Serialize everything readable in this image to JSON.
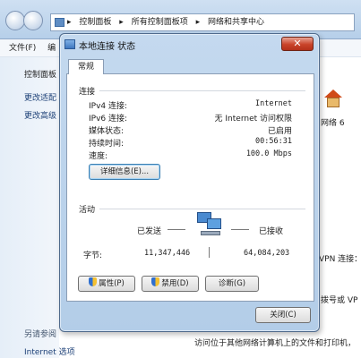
{
  "explorer": {
    "breadcrumb": [
      "控制面板",
      "所有控制面板项",
      "网络和共享中心"
    ],
    "separator": "▸",
    "menu": {
      "file": "文件(F)",
      "edit": "编"
    },
    "sidebar": {
      "home": "控制面板",
      "link1": "更改适配",
      "link2": "更改高级",
      "see_also": "另请参阅",
      "internet_options": "Internet 选项"
    },
    "main": {
      "network_label": "网络 6",
      "vpn_connection": "VPN 连接：",
      "dialup": "拨号或 VP",
      "access_info": "访问位于其他网络计算机上的文件和打印机，"
    }
  },
  "dialog": {
    "title": "本地连接 状态",
    "close_glyph": "✕",
    "tab_general": "常规",
    "connection": {
      "section_title": "连接",
      "rows": [
        {
          "label": "IPv4 连接:",
          "value": "Internet"
        },
        {
          "label": "IPv6 连接:",
          "value": "无 Internet 访问权限"
        },
        {
          "label": "媒体状态:",
          "value": "已启用"
        },
        {
          "label": "持续时间:",
          "value": "00:56:31"
        },
        {
          "label": "速度:",
          "value": "100.0 Mbps"
        }
      ],
      "details_button": "详细信息(E)..."
    },
    "activity": {
      "section_title": "活动",
      "sent_label": "已发送",
      "received_label": "已接收",
      "bytes_label": "字节:",
      "bytes_sent": "11,347,446",
      "bytes_received": "64,084,203"
    },
    "buttons": {
      "properties": "属性(P)",
      "disable": "禁用(D)",
      "diagnose": "诊断(G)",
      "close": "关闭(C)"
    }
  }
}
